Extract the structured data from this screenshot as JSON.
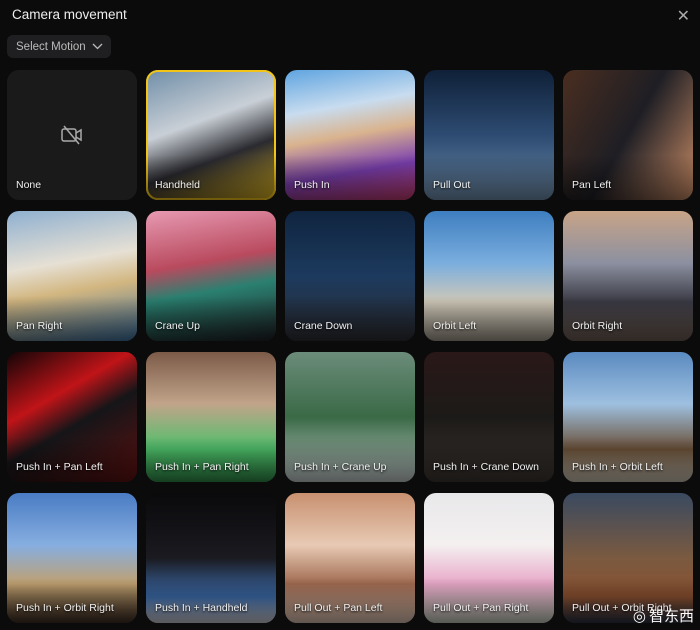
{
  "header": {
    "title": "Camera movement",
    "close_icon": "close-icon"
  },
  "select": {
    "label": "Select Motion",
    "icon": "chevron-down-icon"
  },
  "selected": "Handheld",
  "accent": "#f2c418",
  "tiles": [
    {
      "label": "None",
      "bg": "#1a1a1b"
    },
    {
      "label": "Handheld",
      "bg": "linear-gradient(160deg,#6f8ea8,#c9cfd6 40%,#2a2a30 65%,#d8b020)"
    },
    {
      "label": "Push In",
      "bg": "linear-gradient(170deg,#5fa4e0,#c8dcef 30%,#d9b38e 50%,#7a3fb0 75%,#c03a6a)"
    },
    {
      "label": "Pull Out",
      "bg": "linear-gradient(180deg,#0f2038,#2d4b72 50%,#6d8aa6)"
    },
    {
      "label": "Pan Left",
      "bg": "linear-gradient(120deg,#4a2e20,#1e1e24 50%,#c98c66)"
    },
    {
      "label": "Pan Right",
      "bg": "linear-gradient(170deg,#8fb0d0,#e6e0d4 40%,#d2b680 60%,#3a6d9a)"
    },
    {
      "label": "Crane Up",
      "bg": "linear-gradient(170deg,#e79ab3,#b94a5e 40%,#2a8070 60%,#1d1d22)"
    },
    {
      "label": "Crane Down",
      "bg": "linear-gradient(180deg,#10243f,#1c3a5e 50%,#2c2c30)"
    },
    {
      "label": "Orbit Left",
      "bg": "linear-gradient(180deg,#3e7ec0,#7aaede 40%,#cfc8b8 70%,#9c9588)"
    },
    {
      "label": "Orbit Right",
      "bg": "linear-gradient(180deg,#c8a488,#8c90a0 40%,#3a3a44 70%,#6a5a50)"
    },
    {
      "label": "Push In + Pan Left",
      "bg": "linear-gradient(150deg,#120507,#c01418 35%,#151518 55%,#601010)"
    },
    {
      "label": "Push In + Pan Right",
      "bg": "linear-gradient(180deg,#7c5a48,#c1a48a 40%,#4ec06a 75%,#2f8a48)"
    },
    {
      "label": "Push In + Crane Up",
      "bg": "linear-gradient(180deg,#6b8c7a,#3a6a46 50%,#c0c8c8)"
    },
    {
      "label": "Push In + Crane Down",
      "bg": "linear-gradient(180deg,#2a1818,#1c1a18 50%,#3a3430)"
    },
    {
      "label": "Push In + Orbit Left",
      "bg": "linear-gradient(180deg,#5a8ac0,#9ec0e0 40%,#6a5038 75%,#c8c0b0)"
    },
    {
      "label": "Push In + Orbit Right",
      "bg": "linear-gradient(180deg,#4a7cc4,#86aee0 40%,#c0a070 70%,#3a2a20)"
    },
    {
      "label": "Push In + Handheld",
      "bg": "linear-gradient(180deg,#0a0a0c,#1a1a20 50%,#3c6aa8 80%,#c8c8d0)"
    },
    {
      "label": "Pull Out + Pan Left",
      "bg": "linear-gradient(180deg,#c89070,#e8cab4 40%,#a06a50 70%,#d8c0b0)"
    },
    {
      "label": "Pull Out + Pan Right",
      "bg": "linear-gradient(180deg,#e8e8ea,#f4f0f0 40%,#e8a8c8 70%,#c0c8b8)"
    },
    {
      "label": "Pull Out + Orbit Right",
      "bg": "linear-gradient(180deg,#3a4a60,#7a5a40 50%,#8a5030 80%,#2a3040)"
    }
  ],
  "watermark": {
    "text": "智东西",
    "icon": "weibo-icon"
  }
}
